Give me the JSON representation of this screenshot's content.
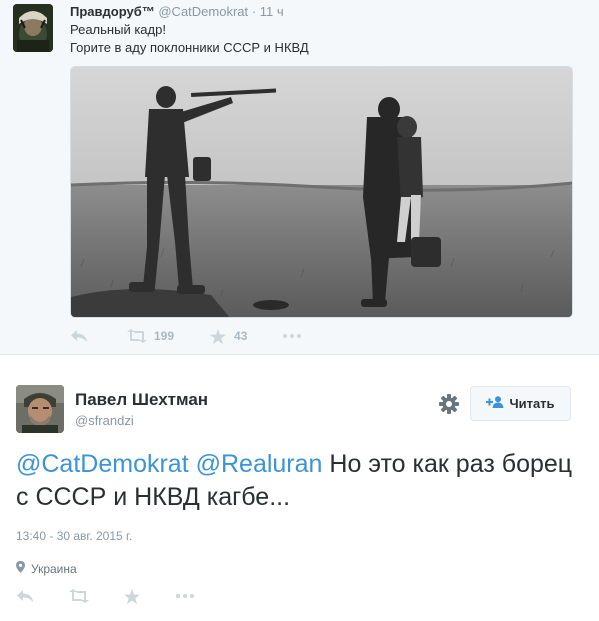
{
  "context_tweet": {
    "author_name": "Правдоруб™",
    "author_handle": "@CatDemokrat",
    "separator": "·",
    "time": "11 ч",
    "text_line1": "Реальный кадр!",
    "text_line2": "Горите в аду поклонники СССР и НКВД",
    "retweet_count": "199",
    "favorite_count": "43",
    "icons": [
      "reply-icon",
      "retweet-icon",
      "favorite-icon",
      "more-icon"
    ]
  },
  "main_tweet": {
    "author_name": "Павел Шехтман",
    "author_handle": "@sfrandzi",
    "follow_label": "Читать",
    "mention1": "@CatDemokrat",
    "mention2": "@Realuran",
    "text_rest": "Но это как раз борец с СССР и НКВД кагбе...",
    "timestamp": "13:40 - 30 авг. 2015 г.",
    "location": "Украина",
    "icons": [
      "gear-icon",
      "follow-icon",
      "location-pin-icon",
      "reply-icon",
      "retweet-icon",
      "favorite-icon",
      "more-icon"
    ]
  },
  "colors": {
    "link": "#3b94d9",
    "muted": "#8899a6",
    "icon": "#aab8c2",
    "text": "#292f33",
    "context_bg": "#f5f8fa"
  }
}
